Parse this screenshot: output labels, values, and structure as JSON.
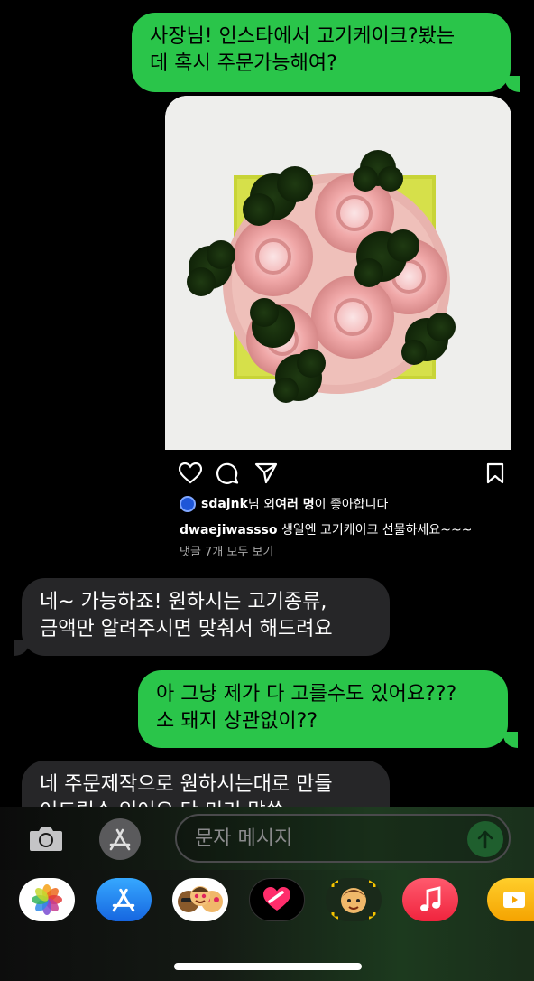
{
  "messages": {
    "out_1": [
      "사장님! 인스타에서 고기케이크?봤는",
      "데 혹시 주문가능해여?"
    ],
    "in_1": [
      "네~ 가능하죠! 원하시는 고기종류,",
      "금액만 알려주시면 맞춰서 해드려요"
    ],
    "out_2": [
      "아 그냥 제가 다 고를수도 있어요???",
      "소 돼지 상관없이??"
    ],
    "in_2": [
      "네 주문제작으로 원하시는대로 만들",
      "어드릴수 있어요 단 미리 말씀"
    ]
  },
  "instagram": {
    "likes_user": "sdajnk",
    "likes_mid": "님 외 ",
    "likes_bold": "여러 명",
    "likes_tail": "이 좋아합니다",
    "caption_user": "dwaejiwassso",
    "caption_text": " 생일엔 고기케이크 선물하세요~~~",
    "comments": "댓글 7개 모두 보기"
  },
  "composer": {
    "placeholder": "문자 메시지"
  },
  "apps": [
    "photos-icon",
    "app-store-icon",
    "memoji-stickers-icon",
    "digital-touch-icon",
    "memoji-icon",
    "music-icon",
    "more-apps-icon"
  ],
  "colors": {
    "outgoing_bubble": "#2ac54a",
    "incoming_bubble": "#262628",
    "background": "#000000"
  }
}
